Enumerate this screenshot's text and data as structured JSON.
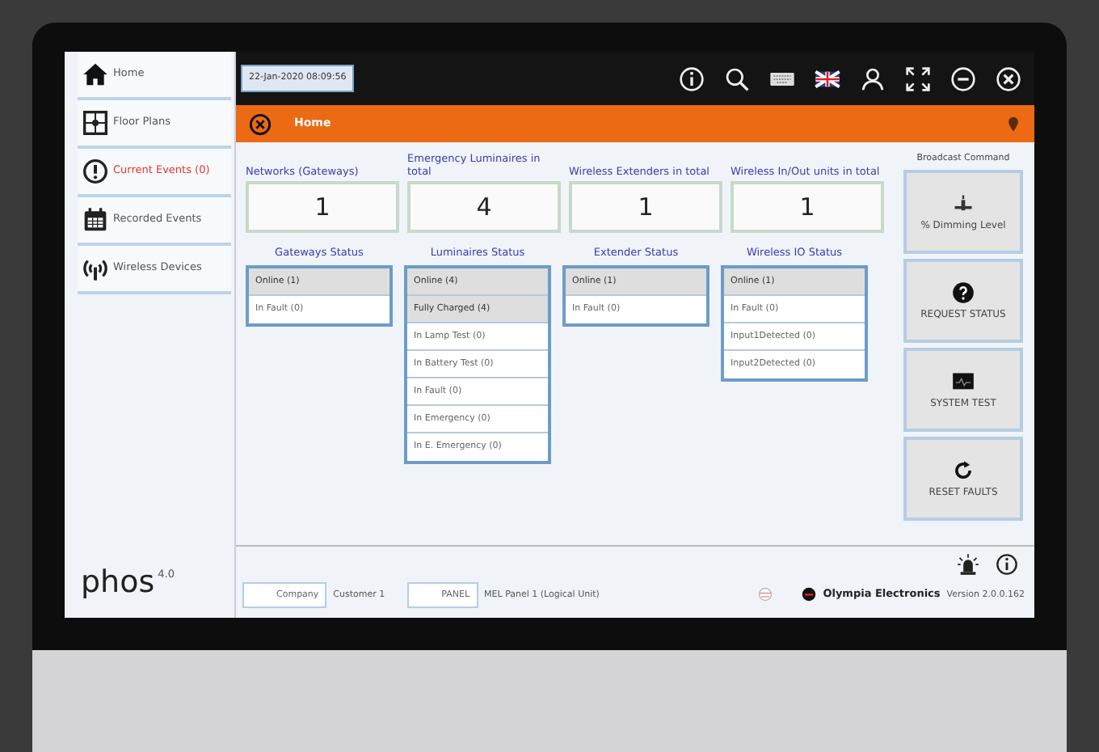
{
  "sidebar": {
    "items": [
      {
        "label": "Home",
        "kind": "home",
        "alert": false
      },
      {
        "label": "Floor Plans",
        "kind": "plan",
        "alert": false
      },
      {
        "label": "Current Events (0)",
        "kind": "events",
        "alert": true
      },
      {
        "label": "Recorded Events",
        "kind": "calendar",
        "alert": false
      },
      {
        "label": "Wireless Devices",
        "kind": "wireless",
        "alert": false
      }
    ]
  },
  "logo": {
    "text": "phos",
    "version": "4.0"
  },
  "top_bar": {
    "datetime": "22-Jan-2020 08:09:56"
  },
  "page_header": {
    "title": "Home"
  },
  "summary": [
    {
      "label": "Networks (Gateways)",
      "value": "1"
    },
    {
      "label": "Emergency Luminaires in total",
      "value": "4"
    },
    {
      "label": "Wireless Extenders in total",
      "value": "1"
    },
    {
      "label": "Wireless In/Out units in total",
      "value": "1"
    }
  ],
  "status_panels": [
    {
      "title": "Gateways Status",
      "rows": [
        {
          "label": "Online (1)",
          "highlighted": true
        },
        {
          "label": "In Fault (0)",
          "highlighted": false
        }
      ]
    },
    {
      "title": "Luminaires Status",
      "rows": [
        {
          "label": "Online (4)",
          "highlighted": true
        },
        {
          "label": "Fully Charged (4)",
          "highlighted": true
        },
        {
          "label": "In Lamp Test (0)",
          "highlighted": false
        },
        {
          "label": "In Battery Test (0)",
          "highlighted": false
        },
        {
          "label": "In Fault (0)",
          "highlighted": false
        },
        {
          "label": "In Emergency (0)",
          "highlighted": false
        },
        {
          "label": "In E. Emergency (0)",
          "highlighted": false
        }
      ]
    },
    {
      "title": "Extender Status",
      "rows": [
        {
          "label": "Online (1)",
          "highlighted": true
        },
        {
          "label": "In Fault (0)",
          "highlighted": false
        }
      ]
    },
    {
      "title": "Wireless IO Status",
      "rows": [
        {
          "label": "Online (1)",
          "highlighted": true
        },
        {
          "label": "In Fault (0)",
          "highlighted": false
        },
        {
          "label": "Input1Detected (0)",
          "highlighted": false
        },
        {
          "label": "Input2Detected (0)",
          "highlighted": false
        }
      ]
    }
  ],
  "broadcast": {
    "title": "Broadcast Command",
    "buttons": [
      {
        "label": "% Dimming Level",
        "kind": "dimming"
      },
      {
        "label": "REQUEST STATUS",
        "kind": "request"
      },
      {
        "label": "SYSTEM TEST",
        "kind": "test"
      },
      {
        "label": "RESET FAULTS",
        "kind": "reset"
      }
    ]
  },
  "footer": {
    "company_label": "Company",
    "company": "Customer 1",
    "panel_label": "PANEL",
    "panel": "MEL Panel 1 (Logical Unit)",
    "brand": "Olympia Electronics",
    "version": "Version 2.0.0.162"
  }
}
